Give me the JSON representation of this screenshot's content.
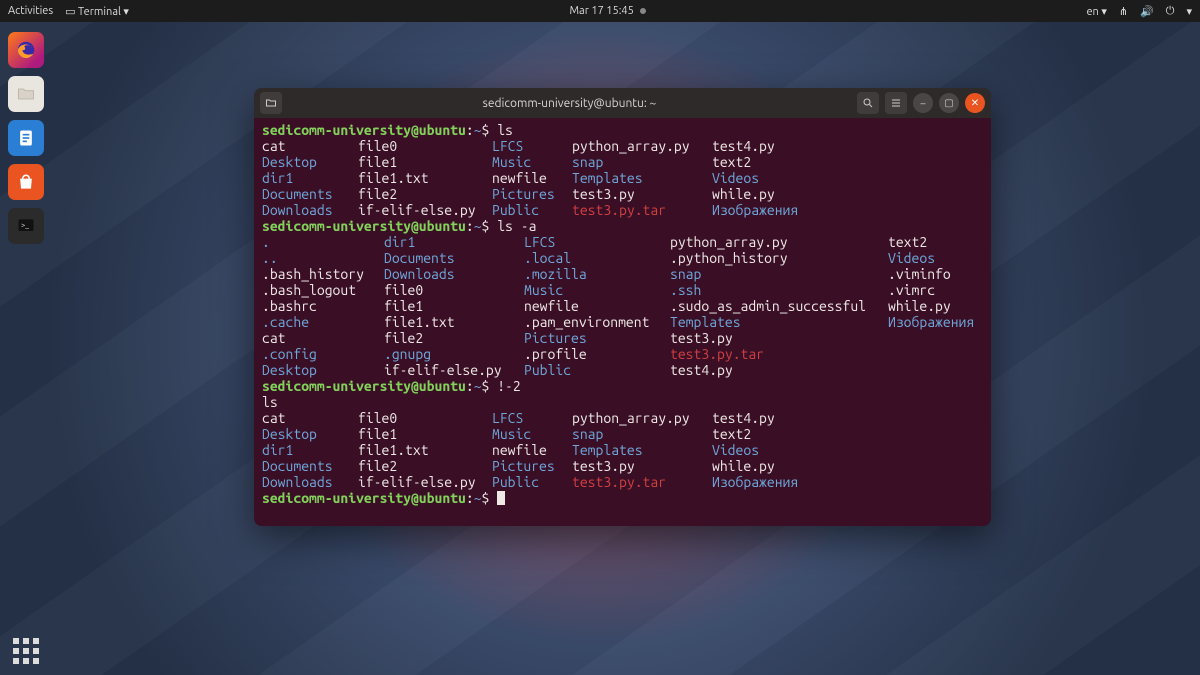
{
  "topbar": {
    "activities": "Activities",
    "terminal_menu": "Terminal",
    "datetime": "Mar 17  15:45",
    "lang": "en"
  },
  "dock": {
    "apps": [
      "firefox",
      "files",
      "writer",
      "store",
      "terminal"
    ],
    "show_apps": "Show Applications"
  },
  "terminal": {
    "title": "sedicomm-university@ubuntu: ~",
    "prompt_user": "sedicomm-university@ubuntu",
    "prompt_path": "~",
    "prompt_sym": "$",
    "cmd1": "ls",
    "cmd2": "ls -a",
    "cmd3": "!-2",
    "cmd3_echo": "ls",
    "ls": {
      "rows": [
        [
          {
            "t": "cat",
            "c": "wt"
          },
          {
            "t": "file0",
            "c": "wt"
          },
          {
            "t": "LFCS",
            "c": "bl"
          },
          {
            "t": "python_array.py",
            "c": "wt"
          },
          {
            "t": "test4.py",
            "c": "wt"
          }
        ],
        [
          {
            "t": "Desktop",
            "c": "bl"
          },
          {
            "t": "file1",
            "c": "wt"
          },
          {
            "t": "Music",
            "c": "bl"
          },
          {
            "t": "snap",
            "c": "bl"
          },
          {
            "t": "text2",
            "c": "wt"
          }
        ],
        [
          {
            "t": "dir1",
            "c": "bl"
          },
          {
            "t": "file1.txt",
            "c": "wt"
          },
          {
            "t": "newfile",
            "c": "wt"
          },
          {
            "t": "Templates",
            "c": "bl"
          },
          {
            "t": "Videos",
            "c": "bl"
          }
        ],
        [
          {
            "t": "Documents",
            "c": "bl"
          },
          {
            "t": "file2",
            "c": "wt"
          },
          {
            "t": "Pictures",
            "c": "bl"
          },
          {
            "t": "test3.py",
            "c": "wt"
          },
          {
            "t": "while.py",
            "c": "wt"
          }
        ],
        [
          {
            "t": "Downloads",
            "c": "bl"
          },
          {
            "t": "if-elif-else.py",
            "c": "wt"
          },
          {
            "t": "Public",
            "c": "bl"
          },
          {
            "t": "test3.py.tar",
            "c": "rd"
          },
          {
            "t": "Изображения",
            "c": "bl"
          }
        ]
      ]
    },
    "ls_a": {
      "rows": [
        [
          {
            "t": ".",
            "c": "bl"
          },
          {
            "t": "dir1",
            "c": "bl"
          },
          {
            "t": "LFCS",
            "c": "bl"
          },
          {
            "t": "python_array.py",
            "c": "wt"
          },
          {
            "t": "text2",
            "c": "wt"
          }
        ],
        [
          {
            "t": "..",
            "c": "bl"
          },
          {
            "t": "Documents",
            "c": "bl"
          },
          {
            "t": ".local",
            "c": "bl"
          },
          {
            "t": ".python_history",
            "c": "wt"
          },
          {
            "t": "Videos",
            "c": "bl"
          }
        ],
        [
          {
            "t": ".bash_history",
            "c": "wt"
          },
          {
            "t": "Downloads",
            "c": "bl"
          },
          {
            "t": ".mozilla",
            "c": "bl"
          },
          {
            "t": "snap",
            "c": "bl"
          },
          {
            "t": ".viminfo",
            "c": "wt"
          }
        ],
        [
          {
            "t": ".bash_logout",
            "c": "wt"
          },
          {
            "t": "file0",
            "c": "wt"
          },
          {
            "t": "Music",
            "c": "bl"
          },
          {
            "t": ".ssh",
            "c": "bl"
          },
          {
            "t": ".vimrc",
            "c": "wt"
          }
        ],
        [
          {
            "t": ".bashrc",
            "c": "wt"
          },
          {
            "t": "file1",
            "c": "wt"
          },
          {
            "t": "newfile",
            "c": "wt"
          },
          {
            "t": ".sudo_as_admin_successful",
            "c": "wt"
          },
          {
            "t": "while.py",
            "c": "wt"
          }
        ],
        [
          {
            "t": ".cache",
            "c": "bl"
          },
          {
            "t": "file1.txt",
            "c": "wt"
          },
          {
            "t": ".pam_environment",
            "c": "wt"
          },
          {
            "t": "Templates",
            "c": "bl"
          },
          {
            "t": "Изображения",
            "c": "bl"
          }
        ],
        [
          {
            "t": "cat",
            "c": "wt"
          },
          {
            "t": "file2",
            "c": "wt"
          },
          {
            "t": "Pictures",
            "c": "bl"
          },
          {
            "t": "test3.py",
            "c": "wt"
          },
          {
            "t": "",
            "c": "wt"
          }
        ],
        [
          {
            "t": ".config",
            "c": "bl"
          },
          {
            "t": ".gnupg",
            "c": "bl"
          },
          {
            "t": ".profile",
            "c": "wt"
          },
          {
            "t": "test3.py.tar",
            "c": "rd"
          },
          {
            "t": "",
            "c": "wt"
          }
        ],
        [
          {
            "t": "Desktop",
            "c": "bl"
          },
          {
            "t": "if-elif-else.py",
            "c": "wt"
          },
          {
            "t": "Public",
            "c": "bl"
          },
          {
            "t": "test4.py",
            "c": "wt"
          },
          {
            "t": "",
            "c": "wt"
          }
        ]
      ]
    }
  }
}
